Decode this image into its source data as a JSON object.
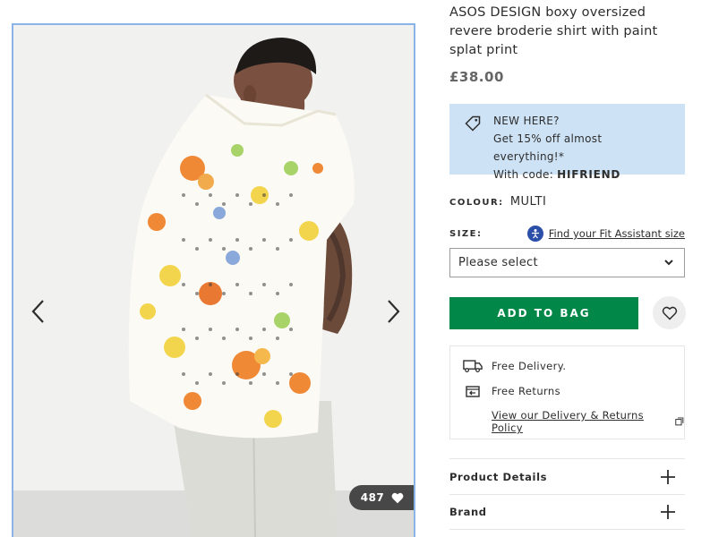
{
  "product": {
    "title": "ASOS DESIGN boxy oversized revere broderie shirt with paint splat print",
    "price": "£38.00"
  },
  "gallery": {
    "likes_count": "487",
    "prev_icon": "chevron-left-icon",
    "next_icon": "chevron-right-icon"
  },
  "promo": {
    "line1": "NEW HERE?",
    "line2": "Get 15% off almost everything!*",
    "line3_prefix": "With code: ",
    "code": "HIFRIEND"
  },
  "colour": {
    "label": "COLOUR:",
    "value": "MULTI"
  },
  "size": {
    "label": "SIZE:",
    "fit_link": "Find your Fit Assistant size",
    "placeholder": "Please select"
  },
  "actions": {
    "add_to_bag": "ADD TO BAG",
    "save_icon": "heart-icon"
  },
  "delivery": {
    "free_delivery": "Free Delivery.",
    "free_returns": "Free Returns",
    "policy_link": "View our Delivery & Returns Policy"
  },
  "accordions": [
    {
      "label": "Product Details"
    },
    {
      "label": "Brand"
    }
  ],
  "colors": {
    "brand_green": "#018849",
    "promo_blue": "#cde2f5",
    "fit_icon_blue": "#2b4fa8"
  }
}
